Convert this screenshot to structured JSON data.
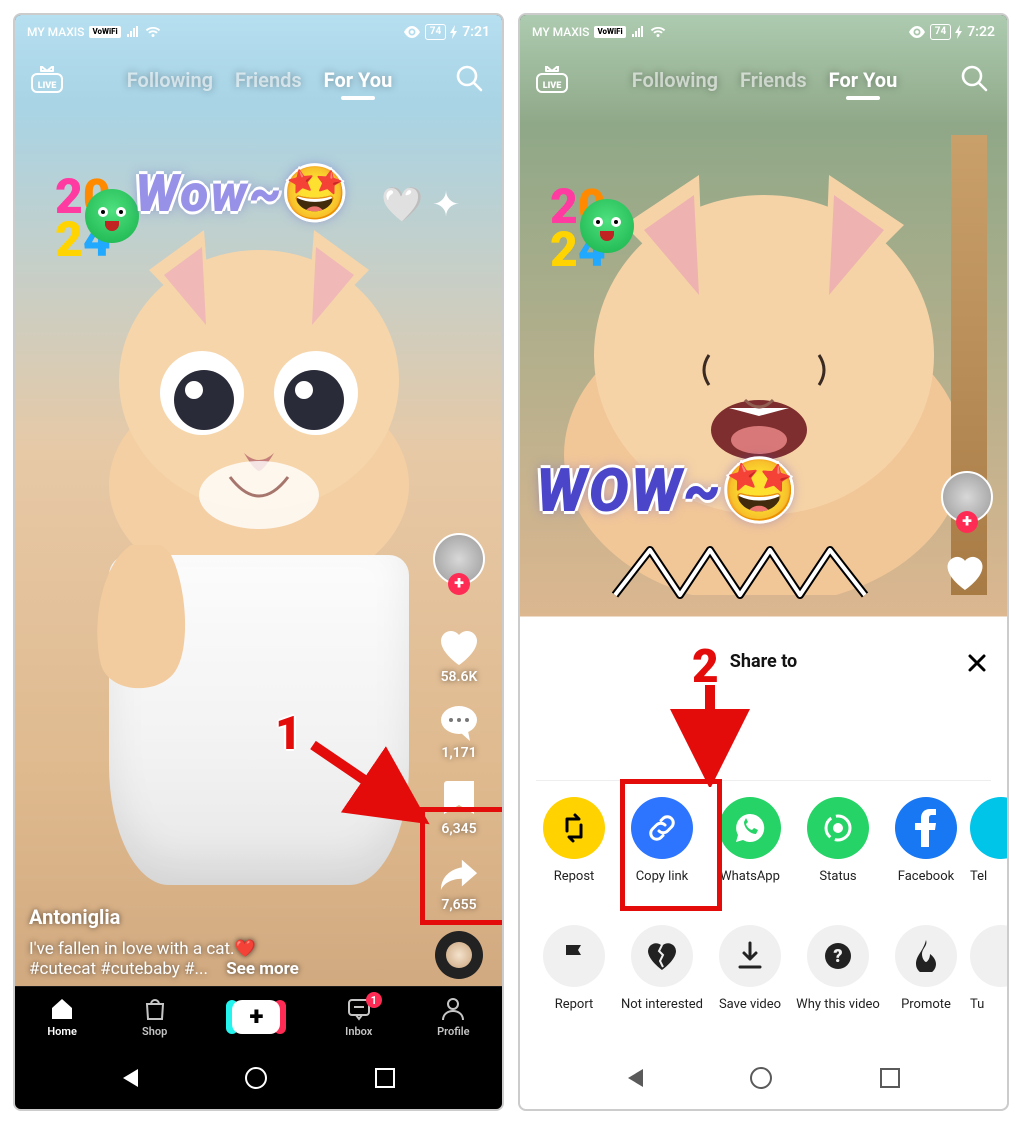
{
  "status": {
    "carrier": "MY MAXIS",
    "carrier_badge": "VoWiFi",
    "battery": "74",
    "time_left": "7:21",
    "time_right": "7:22"
  },
  "header": {
    "tabs": {
      "following": "Following",
      "friends": "Friends",
      "foryou": "For You"
    },
    "live": "LIVE"
  },
  "rail": {
    "likes": "58.6K",
    "comments": "1,171",
    "bookmarks": "6,345",
    "shares": "7,655"
  },
  "caption": {
    "user": "Antoniglia",
    "line": "I've fallen in love with a cat.",
    "tags": "#cutecat #cutebaby #...",
    "more": "See more"
  },
  "bottom": {
    "home": "Home",
    "shop": "Shop",
    "inbox": "Inbox",
    "profile": "Profile",
    "inbox_badge": "1"
  },
  "sticker": {
    "wow": "Wow~",
    "wow_right": "WOW~"
  },
  "share": {
    "title": "Share to",
    "row1": [
      {
        "key": "repost",
        "label": "Repost"
      },
      {
        "key": "copylink",
        "label": "Copy link"
      },
      {
        "key": "whatsapp",
        "label": "WhatsApp"
      },
      {
        "key": "status",
        "label": "Status"
      },
      {
        "key": "facebook",
        "label": "Facebook"
      },
      {
        "key": "telegram",
        "label": "Tel"
      }
    ],
    "row2": [
      {
        "key": "report",
        "label": "Report"
      },
      {
        "key": "notinterested",
        "label": "Not interested"
      },
      {
        "key": "savevideo",
        "label": "Save video"
      },
      {
        "key": "whythisvideo",
        "label": "Why this video"
      },
      {
        "key": "promote",
        "label": "Promote"
      },
      {
        "key": "turnoff",
        "label": "Tu"
      }
    ]
  },
  "annotation": {
    "n1": "1",
    "n2": "2"
  }
}
